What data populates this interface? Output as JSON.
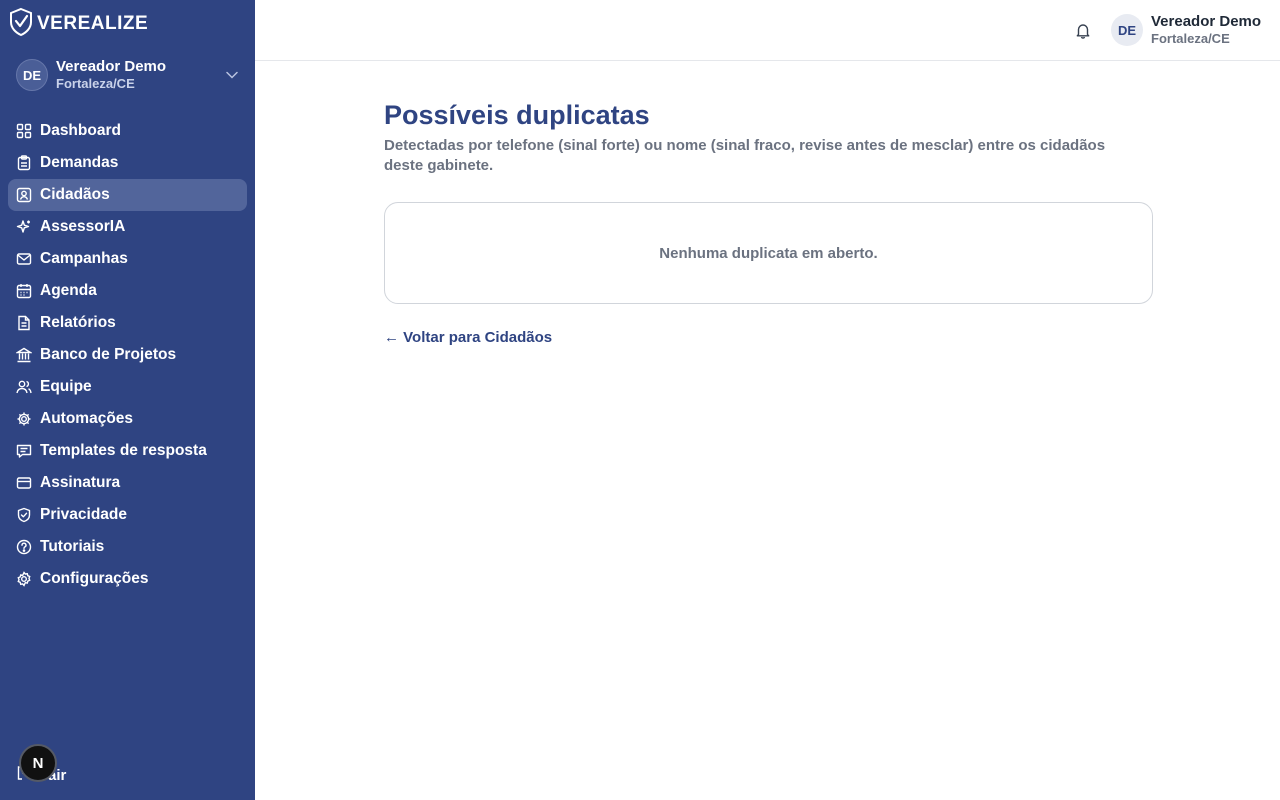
{
  "brand": {
    "name": "VEREALIZE"
  },
  "user": {
    "initials": "DE",
    "name": "Vereador Demo",
    "location": "Fortaleza/CE"
  },
  "sidebar": {
    "items": [
      {
        "label": "Dashboard",
        "icon": "dashboard-icon"
      },
      {
        "label": "Demandas",
        "icon": "clipboard-icon"
      },
      {
        "label": "Cidadãos",
        "icon": "contact-card-icon",
        "active": true
      },
      {
        "label": "AssessorIA",
        "icon": "sparkles-icon"
      },
      {
        "label": "Campanhas",
        "icon": "mail-icon"
      },
      {
        "label": "Agenda",
        "icon": "calendar-icon"
      },
      {
        "label": "Relatórios",
        "icon": "document-icon"
      },
      {
        "label": "Banco de Projetos",
        "icon": "bank-icon"
      },
      {
        "label": "Equipe",
        "icon": "users-icon"
      },
      {
        "label": "Automações",
        "icon": "gear-icon"
      },
      {
        "label": "Templates de resposta",
        "icon": "message-icon"
      },
      {
        "label": "Assinatura",
        "icon": "credit-card-icon"
      },
      {
        "label": "Privacidade",
        "icon": "shield-check-icon"
      },
      {
        "label": "Tutoriais",
        "icon": "help-circle-icon"
      },
      {
        "label": "Configurações",
        "icon": "settings-icon"
      }
    ],
    "logout_label": "Sair",
    "next_badge": "N"
  },
  "page": {
    "title": "Possíveis duplicatas",
    "description": "Detectadas por telefone (sinal forte) ou nome (sinal fraco, revise antes de mesclar) entre os cidadãos deste gabinete.",
    "empty_message": "Nenhuma duplicata em aberto.",
    "back_link": "← Voltar para Cidadãos"
  },
  "colors": {
    "sidebar": "#2f4482",
    "accent": "#2f4482",
    "active_item": "#52659b"
  }
}
